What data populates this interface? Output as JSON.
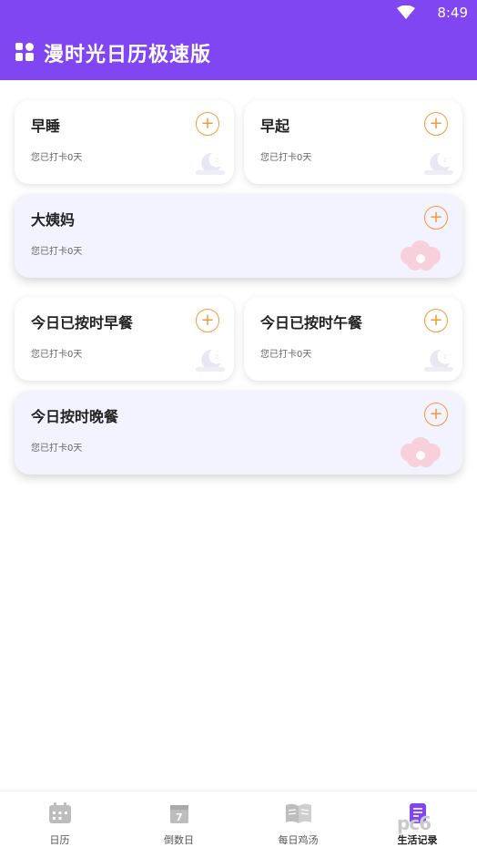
{
  "status_bar": {
    "time": "8:49"
  },
  "app": {
    "title": "漫时光日历极速版"
  },
  "cards": [
    {
      "title": "早睡",
      "subtitle": "您已打卡0天",
      "icon": "moon-icon"
    },
    {
      "title": "早起",
      "subtitle": "您已打卡0天",
      "icon": "moon-icon"
    },
    {
      "title": "大姨妈",
      "subtitle": "您已打卡0天",
      "icon": "flower-icon"
    },
    {
      "title": "今日已按时早餐",
      "subtitle": "您已打卡0天",
      "icon": "moon-icon"
    },
    {
      "title": "今日已按时午餐",
      "subtitle": "您已打卡0天",
      "icon": "moon-icon"
    },
    {
      "title": "今日按时晚餐",
      "subtitle": "您已打卡0天",
      "icon": "flower-icon"
    }
  ],
  "add_label": "+",
  "bottom_nav": [
    {
      "label": "日历",
      "icon": "calendar-icon"
    },
    {
      "label": "倒数日",
      "icon": "countdown-icon"
    },
    {
      "label": "每日鸡汤",
      "icon": "book-icon"
    },
    {
      "label": "生活记录",
      "icon": "notes-icon",
      "active": true
    }
  ],
  "watermark": "pc6",
  "colors": {
    "accent": "#8046f2",
    "add": "#f39a3c",
    "wide_card_bg": "#f3f2ff"
  }
}
